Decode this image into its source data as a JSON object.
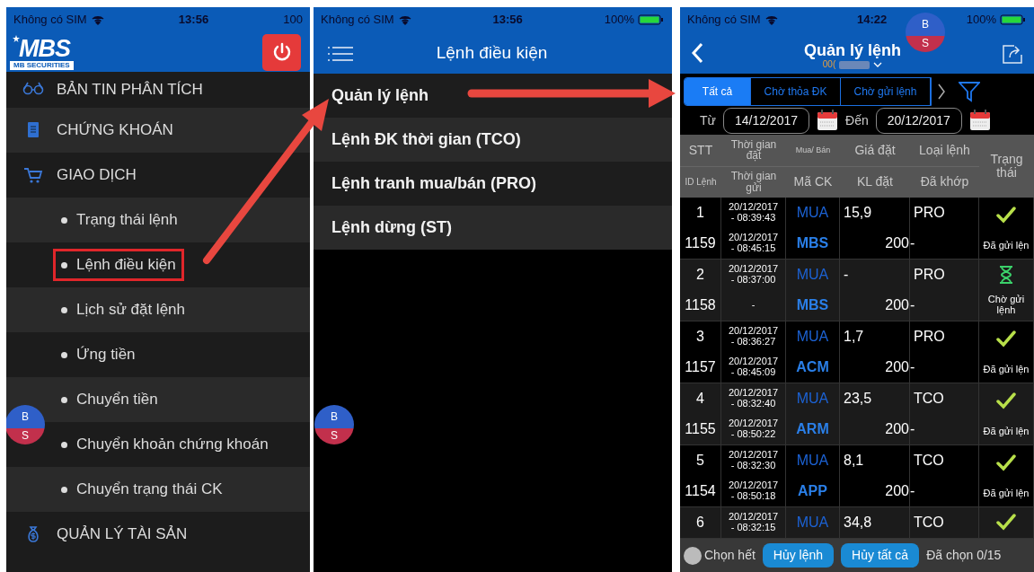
{
  "menu_screen": {
    "status_bar": {
      "carrier": "Không có SIM",
      "time": "13:56",
      "battery": "100"
    },
    "logo": {
      "name": "MBS",
      "tagline": "MB SECURITIES"
    },
    "menu": [
      {
        "label": "BẢN TIN PHÂN TÍCH"
      },
      {
        "label": "CHỨNG KHOÁN"
      },
      {
        "label": "GIAO DỊCH",
        "children": [
          {
            "label": "Trạng thái lệnh",
            "highlighted": false
          },
          {
            "label": "Lệnh điều kiện",
            "highlighted": true
          },
          {
            "label": "Lịch sử đặt lệnh",
            "highlighted": false
          },
          {
            "label": "Ứng tiền",
            "highlighted": false
          },
          {
            "label": "Chuyển tiền",
            "highlighted": false
          },
          {
            "label": "Chuyển khoản chứng khoán",
            "highlighted": false
          },
          {
            "label": "Chuyển trạng thái CK",
            "highlighted": false
          }
        ]
      },
      {
        "label": "QUẢN LÝ TÀI SẢN"
      }
    ],
    "floating_button": {
      "top": "B",
      "bottom": "S"
    }
  },
  "conditional_order_screen": {
    "status_bar": {
      "carrier": "Không có SIM",
      "time": "13:56",
      "battery": "100%"
    },
    "title": "Lệnh điều kiện",
    "items": [
      "Quản lý lệnh",
      "Lệnh ĐK thời gian (TCO)",
      "Lệnh tranh mua/bán (PRO)",
      "Lệnh dừng (ST)"
    ],
    "floating_button": {
      "top": "B",
      "bottom": "S"
    }
  },
  "order_management_screen": {
    "status_bar": {
      "carrier": "Không có SIM",
      "time": "14:22",
      "battery": "100%"
    },
    "title": "Quản lý lệnh",
    "account": "00(",
    "tabs": [
      {
        "label": "Tất cả",
        "selected": true
      },
      {
        "label": "Chờ thỏa ĐK",
        "selected": false
      },
      {
        "label": "Chờ gửi lệnh",
        "selected": false
      }
    ],
    "date_filter": {
      "from_label": "Từ",
      "from": "14/12/2017",
      "to_label": "Đến",
      "to": "20/12/2017"
    },
    "table": {
      "columns": [
        {
          "top": "STT",
          "bottom": "ID Lệnh"
        },
        {
          "top": "Thời gian đặt",
          "bottom": "Thời gian gửi"
        },
        {
          "top": "Mua/ Bán",
          "bottom": "Mã CK"
        },
        {
          "top": "Giá đặt",
          "bottom": "KL đặt"
        },
        {
          "top": "Loại lệnh",
          "bottom": "Đã khớp"
        },
        {
          "top": "Trạng thái"
        }
      ],
      "rows": [
        {
          "stt": "1",
          "order_time": "20/12/2017\n- 08:39:43",
          "side": "MUA",
          "price": "15,9",
          "order_type": "PRO",
          "status": {
            "kind": "sent",
            "text": "Đã gửi lện"
          },
          "id": "1159",
          "send_time": "20/12/2017\n- 08:45:15",
          "symbol": "MBS",
          "quantity": "200",
          "matched": "-"
        },
        {
          "stt": "2",
          "order_time": "20/12/2017\n- 08:37:00",
          "side": "MUA",
          "price": "-",
          "order_type": "PRO",
          "status": {
            "kind": "waiting",
            "text": "Chờ gửi lệnh"
          },
          "id": "1158",
          "send_time": "-",
          "symbol": "MBS",
          "quantity": "200",
          "matched": "-"
        },
        {
          "stt": "3",
          "order_time": "20/12/2017\n- 08:36:27",
          "side": "MUA",
          "price": "1,7",
          "order_type": "PRO",
          "status": {
            "kind": "sent",
            "text": "Đã gửi lện"
          },
          "id": "1157",
          "send_time": "20/12/2017\n- 08:45:09",
          "symbol": "ACM",
          "quantity": "200",
          "matched": "-"
        },
        {
          "stt": "4",
          "order_time": "20/12/2017\n- 08:32:40",
          "side": "MUA",
          "price": "23,5",
          "order_type": "TCO",
          "status": {
            "kind": "sent",
            "text": "Đã gửi lện"
          },
          "id": "1155",
          "send_time": "20/12/2017\n- 08:50:22",
          "symbol": "ARM",
          "quantity": "200",
          "matched": "-"
        },
        {
          "stt": "5",
          "order_time": "20/12/2017\n- 08:32:30",
          "side": "MUA",
          "price": "8,1",
          "order_type": "TCO",
          "status": {
            "kind": "sent",
            "text": "Đã gửi lện"
          },
          "id": "1154",
          "send_time": "20/12/2017\n- 08:50:18",
          "symbol": "APP",
          "quantity": "200",
          "matched": "-"
        },
        {
          "stt": "6",
          "order_time": "20/12/2017\n- 08:32:15",
          "side": "MUA",
          "price": "34,8",
          "order_type": "TCO",
          "status": {
            "kind": "sent"
          }
        }
      ]
    },
    "footer": {
      "select_all": {
        "label": "Chọn hết",
        "checked": false
      },
      "buttons": [
        "Hủy lệnh",
        "Hủy tất cả"
      ],
      "selected_count": "Đã chọn 0/15"
    },
    "floating_button": {
      "top": "B",
      "bottom": "S"
    }
  }
}
